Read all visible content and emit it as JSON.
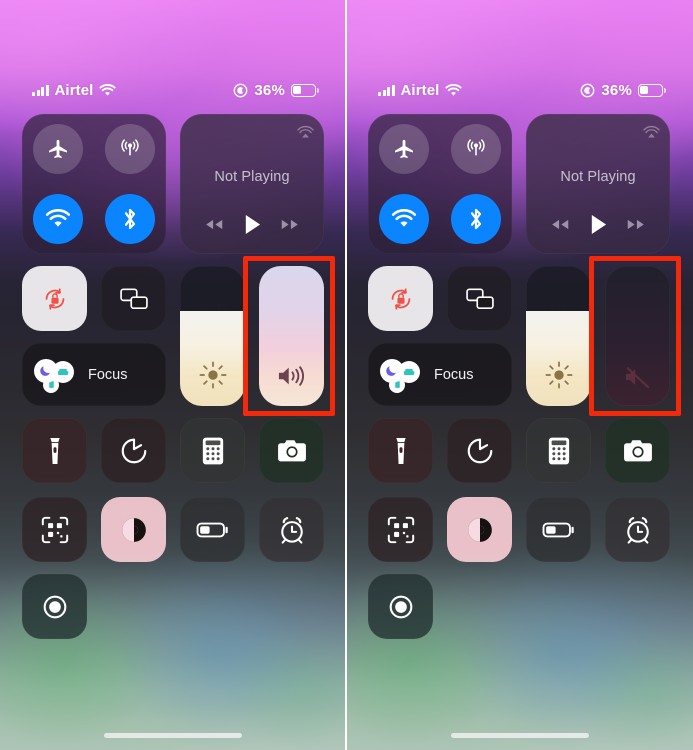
{
  "screenshot": {
    "panels": [
      {
        "id": "left-panel",
        "label": "Control Center with volume on",
        "volume_state": "on",
        "volume_level_percent": 100,
        "annotation": {
          "color": "#f22a0b",
          "target": "volume-slider"
        }
      },
      {
        "id": "right-panel",
        "label": "Control Center with volume muted",
        "volume_state": "muted",
        "volume_level_percent": 0,
        "annotation": {
          "color": "#f22a0b",
          "target": "volume-slider"
        }
      }
    ]
  },
  "status_bar": {
    "carrier": "Airtel",
    "signal_icon": "cellular-signal-icon",
    "wifi_icon": "wifi-icon",
    "focus_indicator_icon": "focus-moon-indicator-icon",
    "battery_percent": "36%",
    "battery_level": 36,
    "battery_icon": "battery-icon"
  },
  "connectivity": {
    "buttons": [
      {
        "name": "airplane-mode",
        "icon": "airplane-icon",
        "state": "off"
      },
      {
        "name": "cellular-data",
        "icon": "cellular-antenna-icon",
        "state": "off"
      },
      {
        "name": "wifi",
        "icon": "wifi-icon",
        "state": "on"
      },
      {
        "name": "bluetooth",
        "icon": "bluetooth-icon",
        "state": "on"
      }
    ]
  },
  "media": {
    "title": "Not Playing",
    "airplay_icon": "airplay-icon",
    "controls": [
      {
        "name": "rewind",
        "icon": "rewind-icon"
      },
      {
        "name": "play",
        "icon": "play-icon"
      },
      {
        "name": "fast-forward",
        "icon": "fast-forward-icon"
      }
    ]
  },
  "toggles": {
    "rotation_lock": {
      "label": "Rotation Lock",
      "icon": "rotation-lock-icon",
      "state": "on",
      "accent": "#f0524a"
    },
    "screen_mirroring": {
      "label": "Screen Mirroring",
      "icon": "screen-mirroring-icon",
      "state": "off"
    }
  },
  "focus": {
    "label": "Focus",
    "icons": [
      {
        "name": "do-not-disturb",
        "icon": "moon-icon",
        "color": "#6c5ce7"
      },
      {
        "name": "sleep",
        "icon": "bed-icon",
        "color": "#2ec4c4"
      },
      {
        "name": "reading",
        "icon": "book-icon",
        "color": "#2ec4c4"
      }
    ]
  },
  "sliders": {
    "brightness": {
      "name": "brightness-slider",
      "icon": "sun-icon",
      "value_percent": 68
    },
    "volume_on": {
      "name": "volume-slider",
      "icon": "speaker-wave-icon",
      "value_percent": 100,
      "state": "on"
    },
    "volume_muted": {
      "name": "volume-slider",
      "icon": "speaker-mute-icon",
      "value_percent": 0,
      "state": "muted"
    }
  },
  "shortcuts": [
    {
      "name": "flashlight",
      "icon": "flashlight-icon",
      "style": "warm",
      "state": "off"
    },
    {
      "name": "timer",
      "icon": "timer-icon",
      "style": "darkwarm",
      "state": "off"
    },
    {
      "name": "calculator",
      "icon": "calculator-icon",
      "style": "grey",
      "state": "off"
    },
    {
      "name": "camera",
      "icon": "camera-icon",
      "style": "green",
      "state": "off"
    },
    {
      "name": "code-scanner",
      "icon": "qr-scanner-icon",
      "style": "darkwarm",
      "state": "off"
    },
    {
      "name": "dark-mode",
      "icon": "dark-mode-icon",
      "style": "pink",
      "state": "on"
    },
    {
      "name": "low-power-mode",
      "icon": "battery-low-power-icon",
      "style": "slate",
      "state": "off"
    },
    {
      "name": "alarm",
      "icon": "alarm-clock-icon",
      "style": "slate2",
      "state": "off"
    },
    {
      "name": "screen-recording",
      "icon": "screen-record-icon",
      "style": "teal",
      "state": "off"
    }
  ],
  "home_indicator": {
    "name": "home-indicator"
  }
}
